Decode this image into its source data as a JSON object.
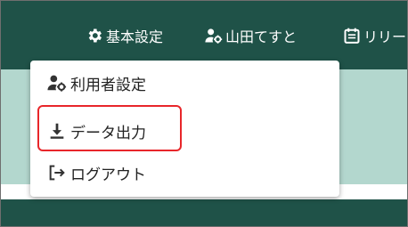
{
  "header": {
    "nav": [
      {
        "label": "基本設定",
        "icon": "gear-icon"
      },
      {
        "label": "山田てすと",
        "icon": "user-gear-icon"
      },
      {
        "label": "リリー",
        "icon": "calendar-icon"
      }
    ]
  },
  "dropdown": {
    "items": [
      {
        "label": "利用者設定",
        "icon": "user-gear-icon"
      },
      {
        "label": "データ出力",
        "icon": "download-icon"
      },
      {
        "label": "ログアウト",
        "icon": "logout-icon"
      }
    ]
  },
  "colors": {
    "header_bg": "#1f5248",
    "content_bg": "#b3d7ce",
    "highlight": "#e8262a"
  }
}
